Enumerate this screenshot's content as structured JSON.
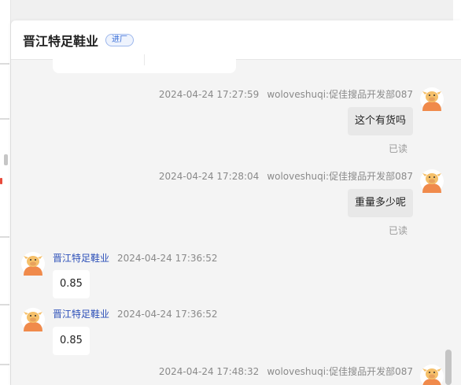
{
  "header": {
    "title": "晋江特足鞋业",
    "badge": "进厂"
  },
  "messages": [
    {
      "direction": "out",
      "timestamp": "2024-04-24 17:27:59",
      "sender": "woloveshuqi:促佳搜品开发部087",
      "text": "这个有货吗",
      "status": "已读"
    },
    {
      "direction": "out",
      "timestamp": "2024-04-24 17:28:04",
      "sender": "woloveshuqi:促佳搜品开发部087",
      "text": "重量多少呢",
      "status": "已读"
    },
    {
      "direction": "in",
      "timestamp": "2024-04-24 17:36:52",
      "sender": "晋江特足鞋业",
      "text": "0.85"
    },
    {
      "direction": "in",
      "timestamp": "2024-04-24 17:36:52",
      "sender": "晋江特足鞋业",
      "text": "0.85"
    },
    {
      "direction": "out",
      "timestamp": "2024-04-24 17:48:32",
      "sender": "woloveshuqi:促佳搜品开发部087"
    }
  ],
  "right_tab": {
    "glyph": "«"
  },
  "avatar_icon": "cartoon-cow-avatar-icon",
  "colors": {
    "avatar_body": "#f08a4b",
    "avatar_face": "#f5c06a",
    "sender_name": "#2c4fb8"
  }
}
